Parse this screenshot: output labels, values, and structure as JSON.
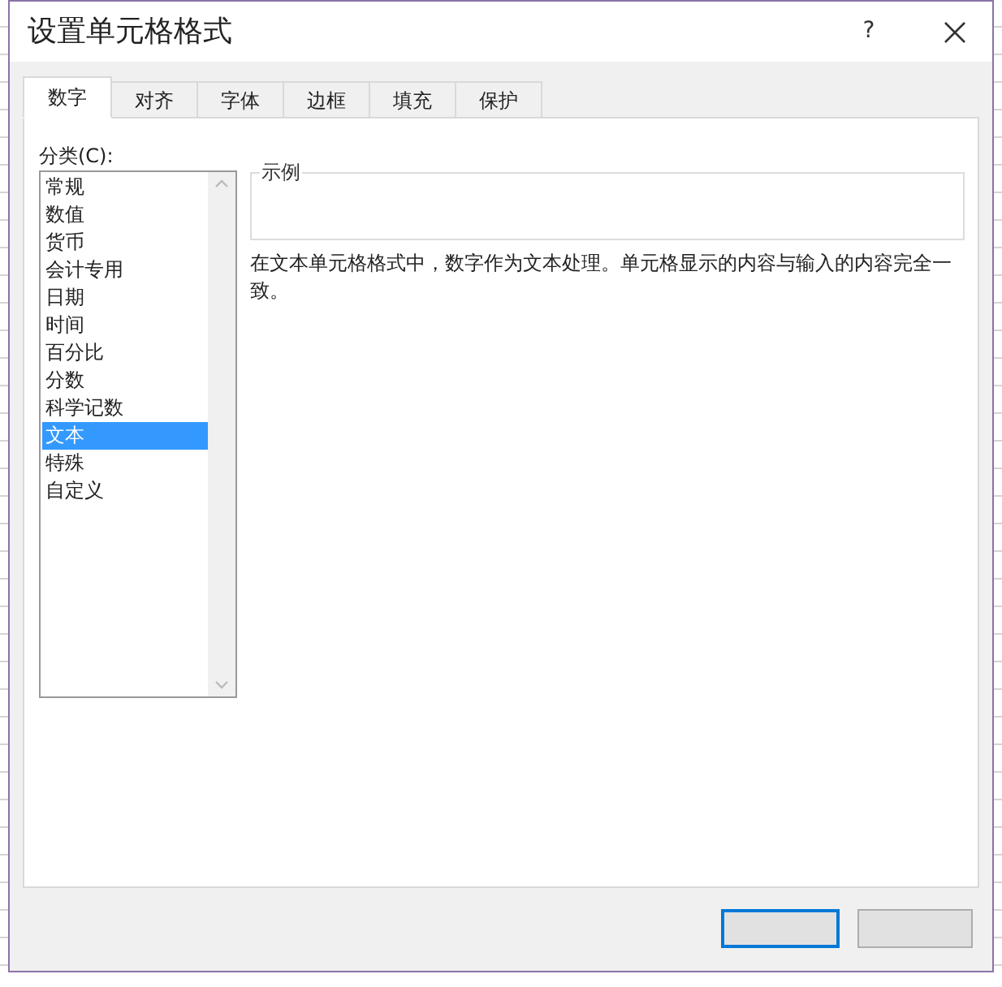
{
  "window": {
    "title": "设置单元格格式",
    "help": "?"
  },
  "tabs": [
    {
      "label": "数字",
      "selected": true
    },
    {
      "label": "对齐",
      "selected": false
    },
    {
      "label": "字体",
      "selected": false
    },
    {
      "label": "边框",
      "selected": false
    },
    {
      "label": "填充",
      "selected": false
    },
    {
      "label": "保护",
      "selected": false
    }
  ],
  "category": {
    "label": "分类(C):",
    "items": [
      {
        "label": "常规",
        "selected": false
      },
      {
        "label": "数值",
        "selected": false
      },
      {
        "label": "货币",
        "selected": false
      },
      {
        "label": "会计专用",
        "selected": false
      },
      {
        "label": "日期",
        "selected": false
      },
      {
        "label": "时间",
        "selected": false
      },
      {
        "label": "百分比",
        "selected": false
      },
      {
        "label": "分数",
        "selected": false
      },
      {
        "label": "科学记数",
        "selected": false
      },
      {
        "label": "文本",
        "selected": true
      },
      {
        "label": "特殊",
        "selected": false
      },
      {
        "label": "自定义",
        "selected": false
      }
    ]
  },
  "sample": {
    "legend": "示例"
  },
  "description": "在文本单元格格式中，数字作为文本处理。单元格显示的内容与输入的内容完全一致。",
  "buttons": [
    {
      "kind": "default"
    },
    {
      "kind": "normal"
    }
  ]
}
